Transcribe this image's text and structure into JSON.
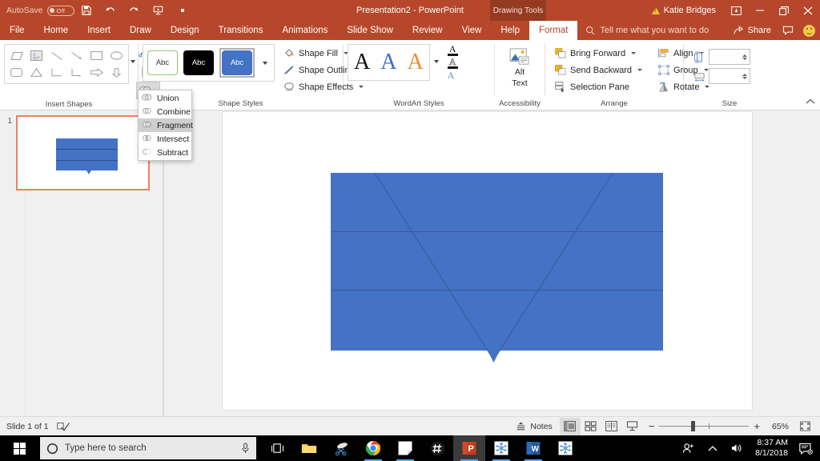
{
  "titlebar": {
    "autosave_label": "AutoSave",
    "autosave_state": "Off",
    "doc_title": "Presentation2  -  PowerPoint",
    "contextual_label": "Drawing Tools",
    "user_name": "Katie Bridges",
    "quick_access": [
      {
        "name": "save-icon",
        "label": "Save"
      },
      {
        "name": "undo-icon",
        "label": "Undo"
      },
      {
        "name": "redo-icon",
        "label": "Redo"
      },
      {
        "name": "start-presentation-icon",
        "label": "Start From Beginning"
      },
      {
        "name": "customize-qat-icon",
        "label": "Customize Quick Access Toolbar"
      }
    ],
    "window_buttons": [
      {
        "name": "ribbon-display-options",
        "glyph": "⬚"
      },
      {
        "name": "minimize-button",
        "glyph": "—"
      },
      {
        "name": "restore-button",
        "glyph": "❐"
      },
      {
        "name": "close-button",
        "glyph": "✕"
      }
    ]
  },
  "tabs": [
    {
      "label": "File",
      "active": false
    },
    {
      "label": "Home",
      "active": false
    },
    {
      "label": "Insert",
      "active": false
    },
    {
      "label": "Draw",
      "active": false
    },
    {
      "label": "Design",
      "active": false
    },
    {
      "label": "Transitions",
      "active": false
    },
    {
      "label": "Animations",
      "active": false
    },
    {
      "label": "Slide Show",
      "active": false
    },
    {
      "label": "Review",
      "active": false
    },
    {
      "label": "View",
      "active": false
    },
    {
      "label": "Help",
      "active": false
    },
    {
      "label": "Format",
      "active": true
    }
  ],
  "tellme": {
    "placeholder": "Tell me what you want to do"
  },
  "share": {
    "label": "Share",
    "comments_label": "Comments"
  },
  "ribbon": {
    "groups": [
      {
        "label": "Insert Shapes"
      },
      {
        "label": "Shape Styles"
      },
      {
        "label": "WordArt Styles"
      },
      {
        "label": "Accessibility"
      },
      {
        "label": "Arrange"
      },
      {
        "label": "Size"
      }
    ],
    "insert_shapes": {
      "shapes": [
        {
          "name": "parallelogram-shape"
        },
        {
          "name": "text-box-shape"
        },
        {
          "name": "line-shape"
        },
        {
          "name": "line-arrow-shape"
        },
        {
          "name": "rectangle-shape"
        },
        {
          "name": "oval-shape"
        },
        {
          "name": "rounded-rectangle-shape"
        },
        {
          "name": "triangle-shape"
        },
        {
          "name": "elbow-connector-shape"
        },
        {
          "name": "elbow-arrow-connector-shape"
        },
        {
          "name": "right-arrow-shape"
        },
        {
          "name": "down-arrow-shape"
        }
      ],
      "edit_shape_label": "Edit Shape",
      "text_box_label": "Text Box",
      "merge_shapes_label": "Merge Shapes"
    },
    "merge_menu": {
      "items": [
        {
          "label": "Union",
          "accel": "U",
          "selected": false
        },
        {
          "label": "Combine",
          "accel": "C",
          "selected": false
        },
        {
          "label": "Fragment",
          "accel": "F",
          "selected": true
        },
        {
          "label": "Intersect",
          "accel": "I",
          "selected": false
        },
        {
          "label": "Subtract",
          "accel": "S",
          "selected": false
        }
      ]
    },
    "shape_styles": {
      "thumbs": [
        {
          "label": "Abc",
          "variant": "white",
          "selected": false
        },
        {
          "label": "Abc",
          "variant": "black",
          "selected": false
        },
        {
          "label": "Abc",
          "variant": "blue",
          "selected": true
        }
      ],
      "commands": [
        {
          "label": "Shape Fill",
          "icon": "paint-bucket-icon"
        },
        {
          "label": "Shape Outline",
          "icon": "pencil-outline-icon"
        },
        {
          "label": "Shape Effects",
          "icon": "shape-effects-icon"
        }
      ]
    },
    "wordart_styles": {
      "thumbs": [
        {
          "label": "A",
          "variant": "black"
        },
        {
          "label": "A",
          "variant": "blue"
        },
        {
          "label": "A",
          "variant": "orange"
        }
      ],
      "commands": [
        {
          "label": "Text Fill",
          "icon": "text-fill-icon"
        },
        {
          "label": "Text Outline",
          "icon": "text-outline-icon"
        },
        {
          "label": "Text Effects",
          "icon": "text-effects-icon"
        }
      ]
    },
    "accessibility": {
      "alt_text_label": "Alt\nText",
      "alt_text_line1": "Alt",
      "alt_text_line2": "Text"
    },
    "arrange": {
      "commands": [
        {
          "label": "Bring Forward",
          "icon": "bring-forward-icon",
          "split": true
        },
        {
          "label": "Send Backward",
          "icon": "send-backward-icon",
          "split": true
        },
        {
          "label": "Selection Pane",
          "icon": "selection-pane-icon",
          "split": false
        },
        {
          "label": "Align",
          "icon": "align-icon",
          "split": true
        },
        {
          "label": "Group",
          "icon": "group-icon",
          "split": true
        },
        {
          "label": "Rotate",
          "icon": "rotate-icon",
          "split": true
        }
      ]
    },
    "size": {
      "height_value": "",
      "width_value": "",
      "height_placeholder": "",
      "width_placeholder": ""
    },
    "collapse_label": "Collapse the Ribbon"
  },
  "thumbnail_pane": {
    "slides": [
      {
        "number": "1",
        "selected": true
      }
    ]
  },
  "slide_canvas": {
    "shape": {
      "name": "blue-rectangle-with-triangle",
      "fill_color": "#4472c4",
      "line_color": "#3a5c98",
      "horizontal_divider_count": 2
    }
  },
  "status_bar": {
    "slide_counter": "Slide 1 of 1",
    "accessibility_label": "Accessibility Checker",
    "notes_label": "Notes",
    "views": [
      {
        "name": "normal-view-button",
        "active": true
      },
      {
        "name": "slide-sorter-view-button",
        "active": false
      },
      {
        "name": "reading-view-button",
        "active": false
      },
      {
        "name": "slide-show-button",
        "active": false
      }
    ],
    "zoom_out_label": "−",
    "zoom_in_label": "+",
    "zoom_level": "65%",
    "fit_slide_label": "Fit slide to current window"
  },
  "taskbar": {
    "start_label": "Start",
    "search_placeholder": "Type here to search",
    "mic_label": "Cortana microphone",
    "items": [
      {
        "name": "task-view-button"
      },
      {
        "name": "file-explorer-button"
      },
      {
        "name": "snipping-tool-button"
      },
      {
        "name": "google-chrome-button"
      },
      {
        "name": "sticky-notes-button"
      },
      {
        "name": "hashtag-app-button"
      },
      {
        "name": "powerpoint-button"
      },
      {
        "name": "snowflake-app-button"
      },
      {
        "name": "word-button"
      },
      {
        "name": "snowflake-app-2-button"
      }
    ],
    "tray": {
      "people_label": "People",
      "show_hidden_label": "Show hidden icons",
      "volume_label": "Volume",
      "time": "8:37 AM",
      "date": "8/1/2018",
      "action_center_label": "Action Center"
    }
  }
}
